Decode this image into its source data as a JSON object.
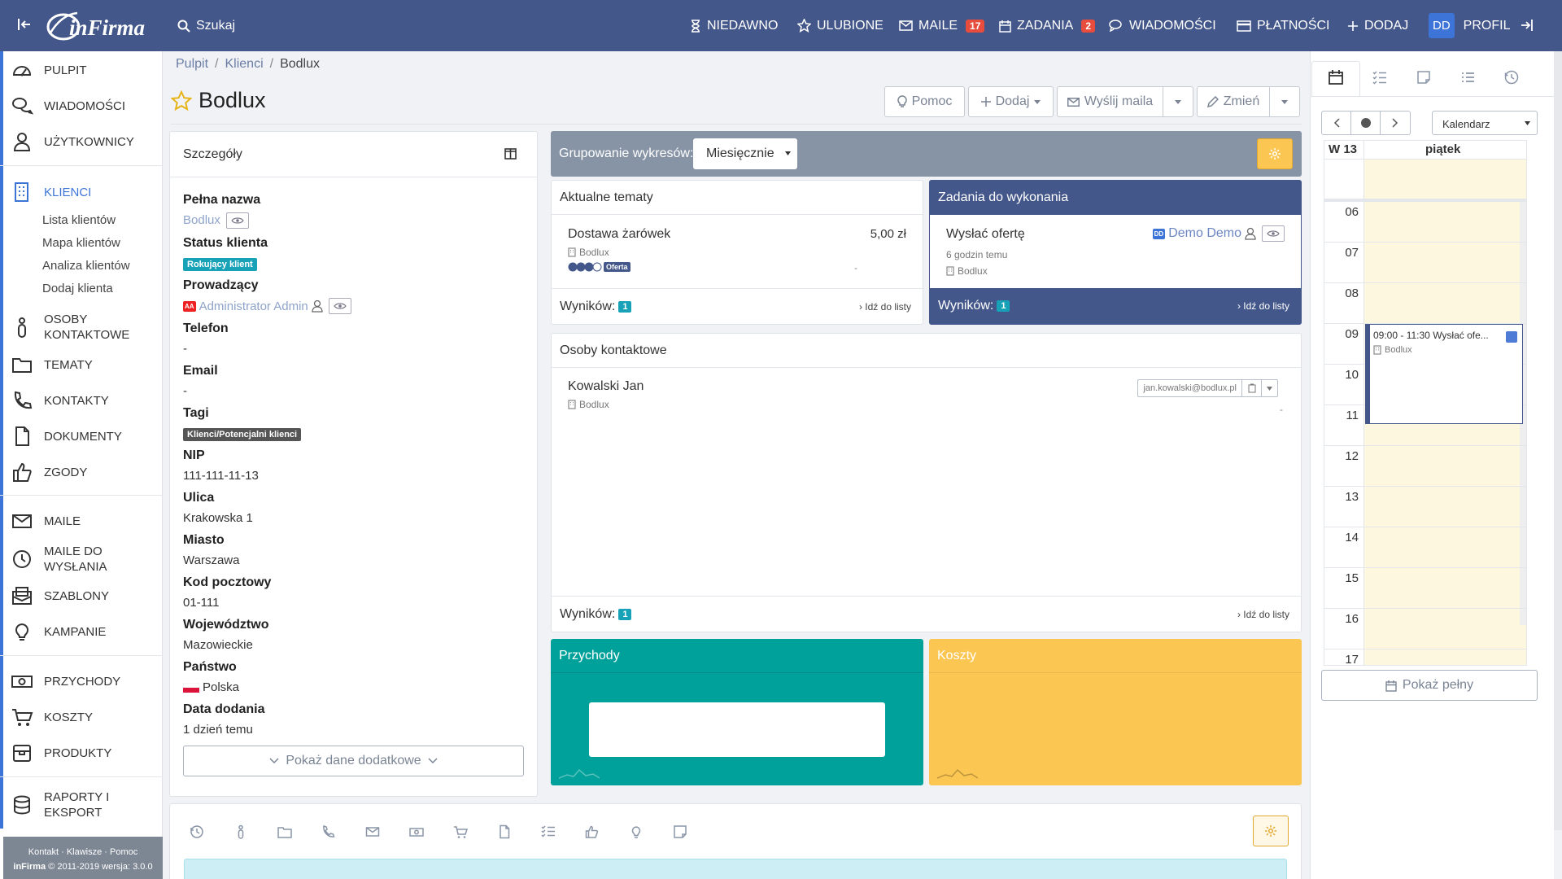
{
  "topbar": {
    "search": "Szukaj",
    "items": [
      {
        "label": "NIEDAWNO"
      },
      {
        "label": "ULUBIONE"
      },
      {
        "label": "MAILE",
        "count": "17"
      },
      {
        "label": "ZADANIA",
        "count": "2"
      },
      {
        "label": "WIADOMOŚCI"
      },
      {
        "label": "PŁATNOŚCI"
      },
      {
        "label": "DODAJ"
      },
      {
        "label": "PROFIL",
        "avatar": "DD"
      }
    ]
  },
  "sidebar": {
    "items": [
      {
        "label": "PULPIT",
        "icon": "dashboard-icon"
      },
      {
        "label": "WIADOMOŚCI",
        "icon": "chat-icon"
      },
      {
        "label": "UŻYTKOWNICY",
        "icon": "user-icon"
      },
      {
        "label": "KLIENCI",
        "icon": "building-icon"
      },
      {
        "label": "OSOBY KONTAKTOWE",
        "icon": "person-icon"
      },
      {
        "label": "TEMATY",
        "icon": "folder-icon"
      },
      {
        "label": "KONTAKTY",
        "icon": "phone-icon"
      },
      {
        "label": "DOKUMENTY",
        "icon": "document-icon"
      },
      {
        "label": "ZGODY",
        "icon": "thumbs-up-icon"
      },
      {
        "label": "MAILE",
        "icon": "mail-icon"
      },
      {
        "label": "MAILE DO WYSŁANIA",
        "icon": "clock-icon"
      },
      {
        "label": "SZABLONY",
        "icon": "template-icon"
      },
      {
        "label": "KAMPANIE",
        "icon": "bulb-icon"
      },
      {
        "label": "PRZYCHODY",
        "icon": "money-icon"
      },
      {
        "label": "KOSZTY",
        "icon": "cart-icon"
      },
      {
        "label": "PRODUKTY",
        "icon": "box-icon"
      },
      {
        "label": "RAPORTY I EKSPORT",
        "icon": "database-icon"
      }
    ],
    "subitems": [
      "Lista klientów",
      "Mapa klientów",
      "Analiza klientów",
      "Dodaj klienta"
    ],
    "footer_links": "Kontakt · Klawisze · Pomoc",
    "footer_brand": "inFirma",
    "footer_copy": " © 2011-2019 wersja: 3.0.0"
  },
  "breadcrumb": {
    "items": [
      "Pulpit",
      "Klienci",
      "Bodlux"
    ],
    "sep": "/"
  },
  "page": {
    "title": "Bodlux"
  },
  "toolbar": {
    "help": "Pomoc",
    "add": "Dodaj",
    "send": "Wyślij maila",
    "change": "Zmień"
  },
  "details": {
    "header": "Szczegóły",
    "fields": [
      {
        "label": "Pełna nazwa",
        "value": "Bodlux"
      },
      {
        "label": "Status klienta",
        "value": "Rokujący klient"
      },
      {
        "label": "Prowadzący",
        "value": "Administrator Admin",
        "avatar": "AA"
      },
      {
        "label": "Telefon",
        "value": "-"
      },
      {
        "label": "Email",
        "value": "-"
      },
      {
        "label": "Tagi",
        "value": "Klienci/Potencjalni klienci"
      },
      {
        "label": "NIP",
        "value": "111-111-11-13"
      },
      {
        "label": "Ulica",
        "value": "Krakowska 1"
      },
      {
        "label": "Miasto",
        "value": "Warszawa"
      },
      {
        "label": "Kod pocztowy",
        "value": "01-111"
      },
      {
        "label": "Województwo",
        "value": "Mazowieckie"
      },
      {
        "label": "Państwo",
        "value": "Polska"
      },
      {
        "label": "Data dodania",
        "value": "1 dzień temu"
      }
    ],
    "more": "Pokaż dane dodatkowe"
  },
  "grouping": {
    "label": "Grupowanie wykresów:",
    "value": "Miesięcznie"
  },
  "topics": {
    "header": "Aktualne tematy",
    "item": {
      "title": "Dostawa żarówek",
      "amount": "5,00 zł",
      "client": "Bodlux",
      "stage": "Oferta",
      "dash": "-"
    },
    "results": "Wyników:",
    "count": "1",
    "go": "Idź do listy"
  },
  "tasks": {
    "header": "Zadania do wykonania",
    "item": {
      "title": "Wysłać ofertę",
      "owner": "Demo Demo",
      "owner_avatar": "DD",
      "time": "6 godzin temu",
      "client": "Bodlux"
    },
    "results": "Wyników:",
    "count": "1",
    "go": "Idź do listy"
  },
  "contacts": {
    "header": "Osoby kontaktowe",
    "item": {
      "name": "Kowalski Jan",
      "client": "Bodlux",
      "email": "jan.kowalski@bodlux.pl",
      "dash": "-"
    },
    "results": "Wyników:",
    "count": "1",
    "go": "Idź do listy"
  },
  "revenue": {
    "header": "Przychody",
    "color": "#00a19a"
  },
  "costs": {
    "header": "Koszty",
    "color": "#fcc653"
  },
  "calendar": {
    "view": "Kalendarz",
    "week": "W 13",
    "day": "piątek",
    "hours": [
      "06",
      "07",
      "08",
      "09",
      "10",
      "11",
      "12",
      "13",
      "14",
      "15",
      "16",
      "17"
    ],
    "event": {
      "time": "09:00 - 11:30",
      "title": "Wysłać ofe...",
      "client": "Bodlux"
    },
    "show_full": "Pokaż pełny"
  }
}
